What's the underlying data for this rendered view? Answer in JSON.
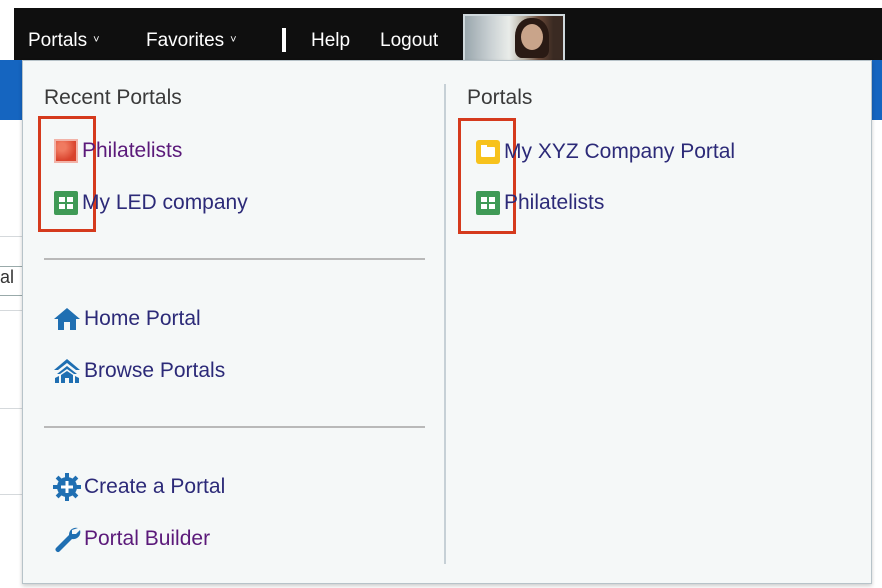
{
  "topnav": {
    "portals_label": "Portals",
    "favorites_label": "Favorites",
    "help_label": "Help",
    "logout_label": "Logout",
    "chevron": "˅"
  },
  "background": {
    "fragment": "al"
  },
  "dropdown": {
    "recent": {
      "heading": "Recent Portals",
      "items": [
        {
          "label": "Philatelists",
          "icon": "stamp-icon"
        },
        {
          "label": "My LED company",
          "icon": "portal-grid-icon"
        }
      ]
    },
    "links": [
      {
        "label": "Home Portal",
        "icon": "home-icon"
      },
      {
        "label": "Browse Portals",
        "icon": "browse-portals-icon"
      }
    ],
    "actions": [
      {
        "label": "Create a Portal",
        "icon": "gear-plus-icon"
      },
      {
        "label": "Portal Builder",
        "icon": "wrench-icon"
      }
    ],
    "portals": {
      "heading": "Portals",
      "items": [
        {
          "label": "My XYZ Company Portal",
          "icon": "folder-icon"
        },
        {
          "label": "Philatelists",
          "icon": "portal-grid-icon"
        }
      ]
    }
  },
  "colors": {
    "nav_bg": "#0f0f0f",
    "panel_bg": "#f5f8f8",
    "highlight": "#d53a1d",
    "link_purple": "#5b1a7a",
    "link_navy": "#2c2a78",
    "icon_blue": "#1f6fb2",
    "accent_blue": "#1565c0"
  }
}
